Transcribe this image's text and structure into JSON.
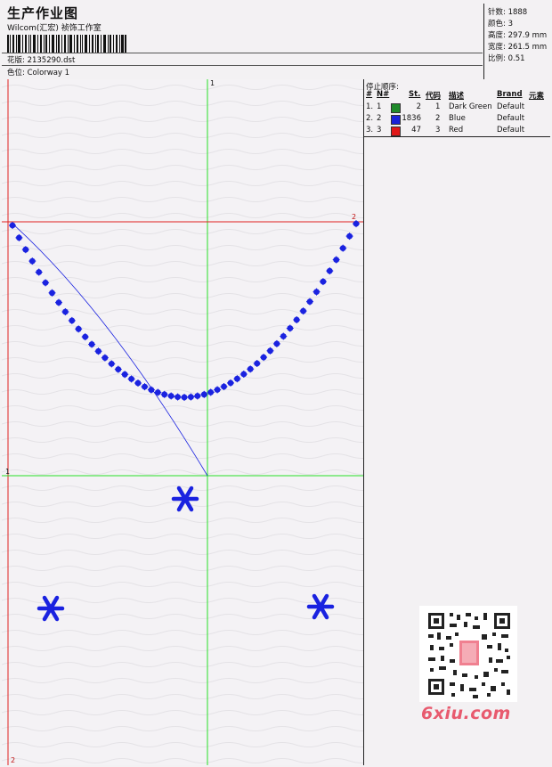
{
  "header": {
    "title": "生产作业图",
    "company": "Wilcom(汇宏) 祯饰工作室",
    "design_label": "花版: 2135290.dst",
    "colorway_label": "色位: Colorway 1"
  },
  "specs": [
    {
      "label": "针数:",
      "value": "1888"
    },
    {
      "label": "颜色:",
      "value": "3"
    },
    {
      "label": "高度:",
      "value": "297.9 mm"
    },
    {
      "label": "宽度:",
      "value": "261.5 mm"
    },
    {
      "label": "比例:",
      "value": "0.51"
    }
  ],
  "stop_sequence": {
    "title": "停止顺序:",
    "columns": [
      "#",
      "N#",
      "St.",
      "代码",
      "描述",
      "Brand",
      "元素"
    ],
    "rows": [
      {
        "idx": "1.",
        "n": "1",
        "color": "#1f8a2a",
        "st": "2",
        "code": "1",
        "desc": "Dark Green",
        "brand": "Default",
        "element": ""
      },
      {
        "idx": "2.",
        "n": "2",
        "color": "#1a22d8",
        "st": "1836",
        "code": "2",
        "desc": "Blue",
        "brand": "Default",
        "element": ""
      },
      {
        "idx": "3.",
        "n": "3",
        "color": "#e01818",
        "st": "47",
        "code": "3",
        "desc": "Red",
        "brand": "Default",
        "element": ""
      }
    ]
  },
  "axis_labels": {
    "top": "1",
    "right": "2",
    "left": "1",
    "bottom": "2"
  },
  "watermark": {
    "text": "6xiu.com"
  },
  "colors": {
    "stitch_blue": "#1a22e0",
    "guide_green": "#27e027",
    "guide_red": "#e02020"
  }
}
